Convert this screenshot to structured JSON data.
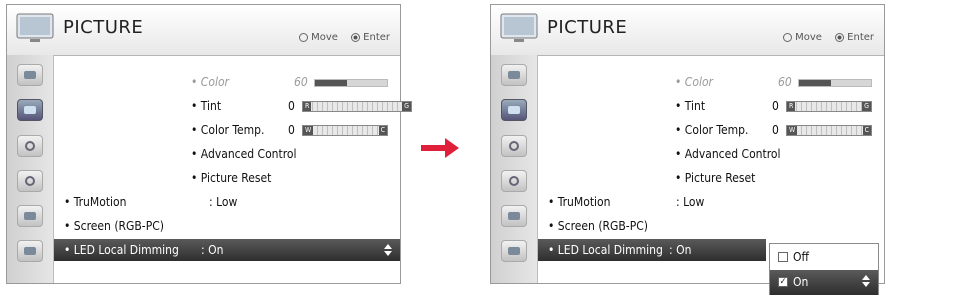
{
  "menu": {
    "title": "PICTURE",
    "hint_move": "Move",
    "hint_enter": "Enter",
    "sidebar_icons": [
      "picture-category-icon",
      "tv-picture-icon",
      "audio-speaker-icon",
      "clock-icon",
      "lock-icon",
      "options-icon"
    ],
    "items": {
      "color": {
        "label": "• Color",
        "value": "60",
        "level": 0.45
      },
      "tint": {
        "label": "• Tint",
        "value": "0",
        "left": "R",
        "right": "G"
      },
      "color_temp": {
        "label": "• Color Temp.",
        "value": "0",
        "left": "W",
        "right": "C"
      },
      "advanced": {
        "label": "• Advanced Control"
      },
      "reset": {
        "label": "• Picture Reset"
      },
      "trumotion": {
        "label": "• TruMotion",
        "value": ": Low"
      },
      "screen": {
        "label": "• Screen (RGB-PC)"
      },
      "led": {
        "label": "• LED Local Dimming",
        "value": ": On"
      }
    }
  },
  "dropdown": {
    "options": [
      {
        "label": "Off",
        "checked": false,
        "mark": ""
      },
      {
        "label": "On",
        "checked": true,
        "mark": "✓"
      }
    ]
  },
  "colors": {
    "selected_bg": "#3a3a3a",
    "arrow": "#e0203a"
  }
}
